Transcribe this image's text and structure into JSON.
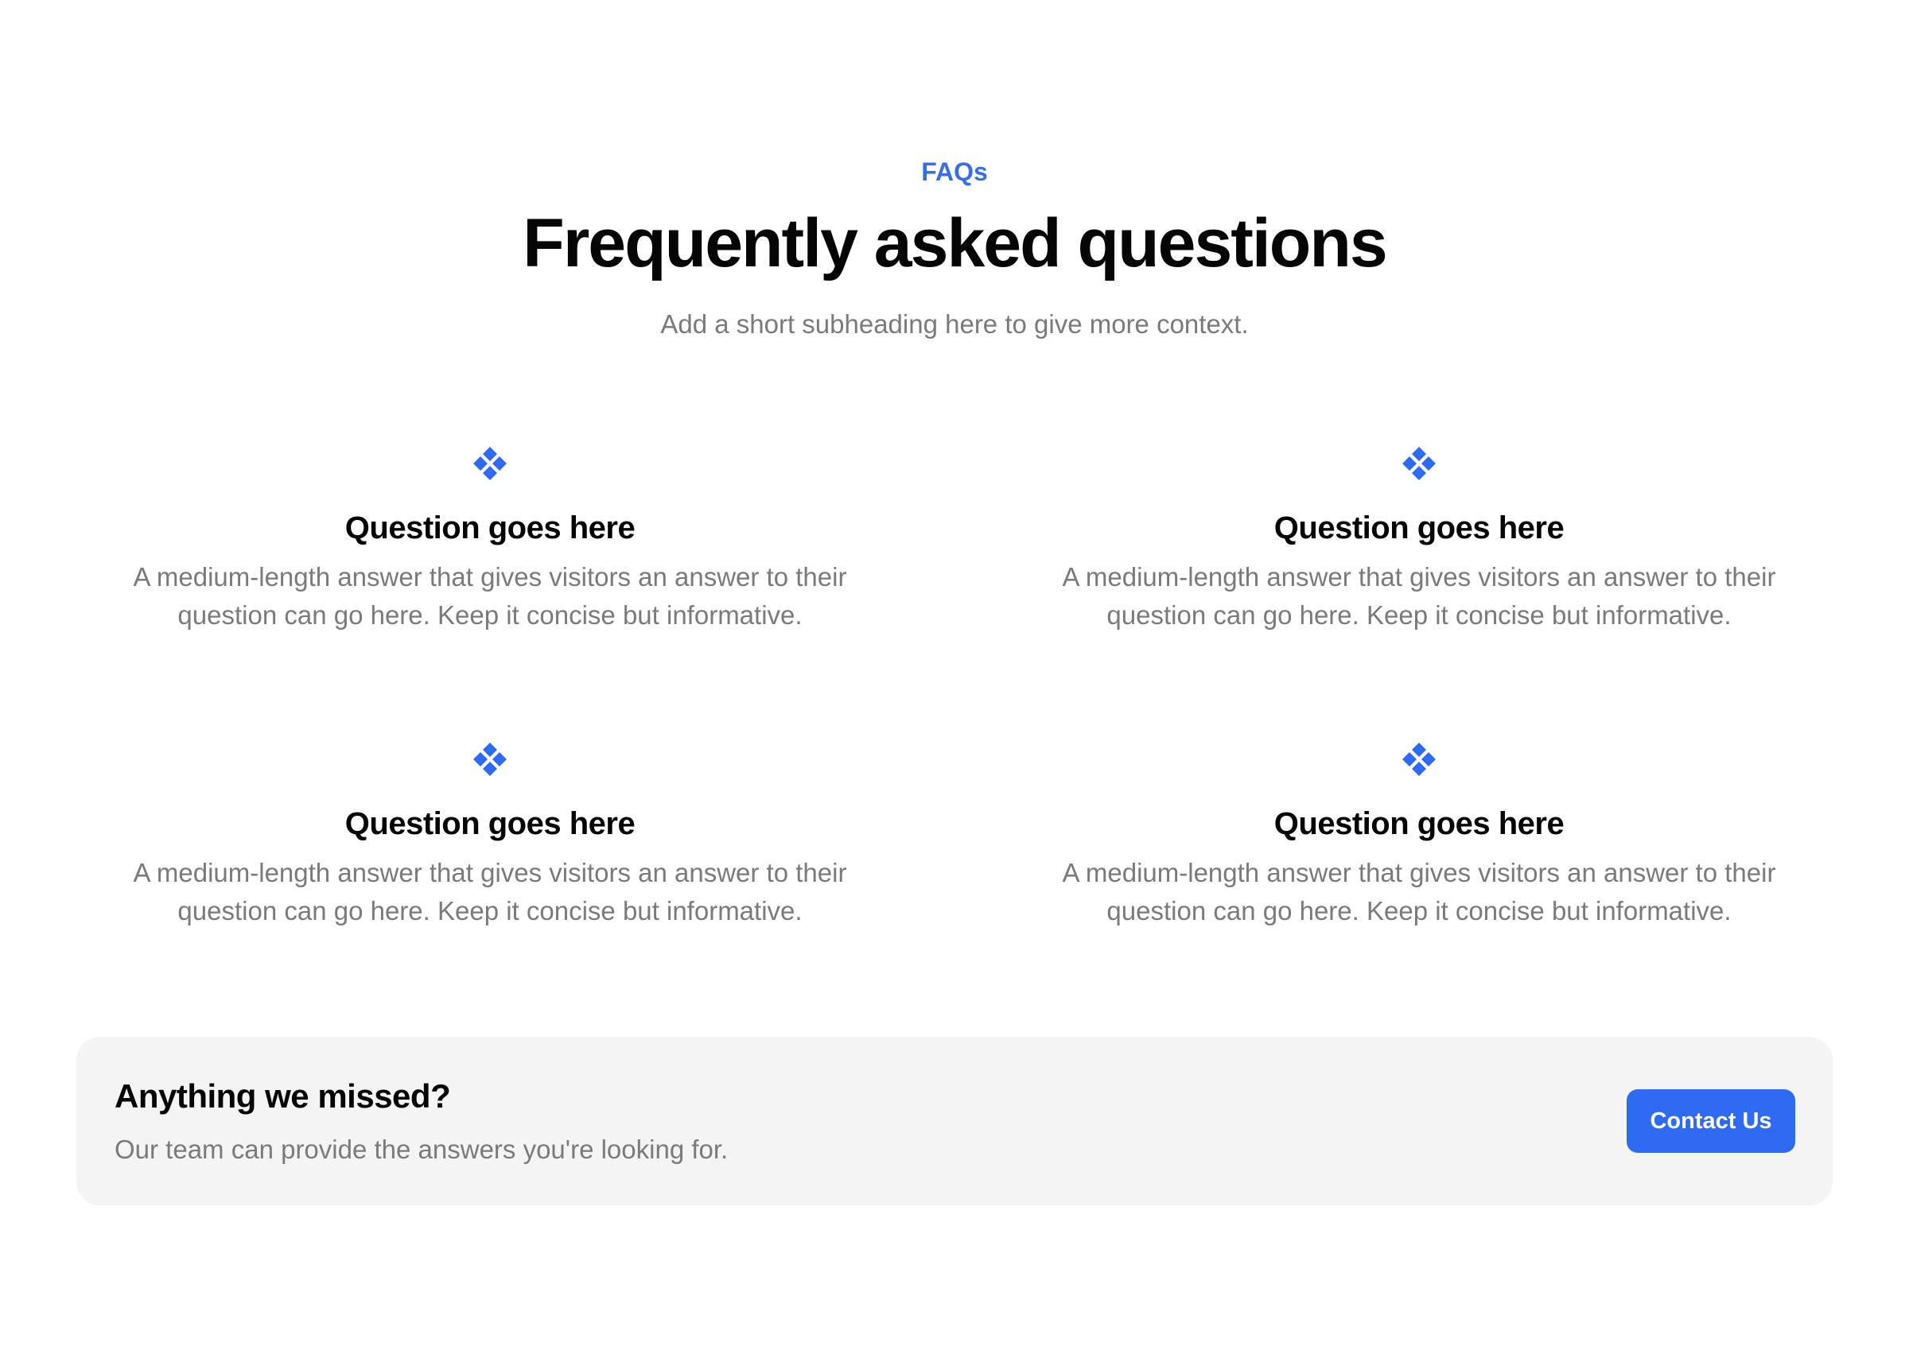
{
  "header": {
    "eyebrow": "FAQs",
    "title": "Frequently asked questions",
    "subtitle": "Add a short subheading here to give more context."
  },
  "faqs": [
    {
      "icon": "diamond-cluster-icon",
      "question": "Question goes here",
      "answer": "A medium-length answer that gives visitors an answer to their question can go here. Keep it concise but informative."
    },
    {
      "icon": "diamond-cluster-icon",
      "question": "Question goes here",
      "answer": "A medium-length answer that gives visitors an answer to their question can go here. Keep it concise but informative."
    },
    {
      "icon": "diamond-cluster-icon",
      "question": "Question goes here",
      "answer": "A medium-length answer that gives visitors an answer to their question can go here. Keep it concise but informative."
    },
    {
      "icon": "diamond-cluster-icon",
      "question": "Question goes here",
      "answer": "A medium-length answer that gives visitors an answer to their question can go here. Keep it concise but informative."
    }
  ],
  "cta": {
    "title": "Anything we missed?",
    "text": "Our team can provide the answers you're looking for.",
    "button_label": "Contact Us"
  },
  "colors": {
    "accent": "#2f6af2",
    "eyebrow": "#3a6fe0",
    "heading": "#050505",
    "muted_text": "#7a7a7a",
    "card_background": "#f4f4f4"
  }
}
